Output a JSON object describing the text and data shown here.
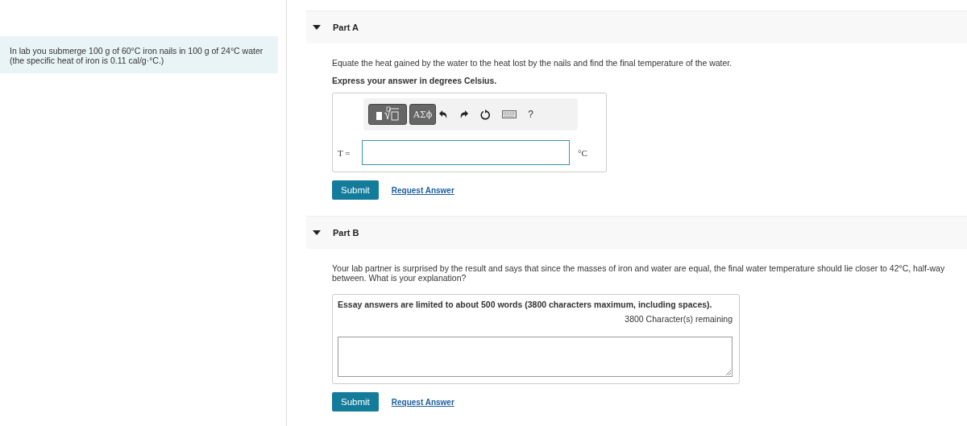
{
  "problem": {
    "text": "In lab you submerge 100 g of 60°C iron nails in 100 g of 24°C water (the specific heat of iron is 0.11 cal/g·°C.)"
  },
  "parts": [
    {
      "kind": "math",
      "title": "Part A",
      "expanded": true,
      "prompt": "Equate the heat gained by the water to the heat lost by the nails and find the final temperature of the water.",
      "instruction": "Express your answer in degrees Celsius.",
      "toolbar": {
        "greek": "ΑΣϕ",
        "help": "?"
      },
      "variable": "T =",
      "unit": "°C",
      "submit": "Submit",
      "request": "Request Answer"
    },
    {
      "kind": "essay",
      "title": "Part B",
      "expanded": true,
      "prompt": "Your lab partner is surprised by the result and says that since the masses of iron and water are equal, the final water temperature should lie closer to 42°C, half-way between. What is your explanation?",
      "limit_note": "Essay answers are limited to about 500 words (3800 characters maximum, including spaces).",
      "remaining": "3800 Character(s) remaining",
      "submit": "Submit",
      "request": "Request Answer"
    }
  ]
}
